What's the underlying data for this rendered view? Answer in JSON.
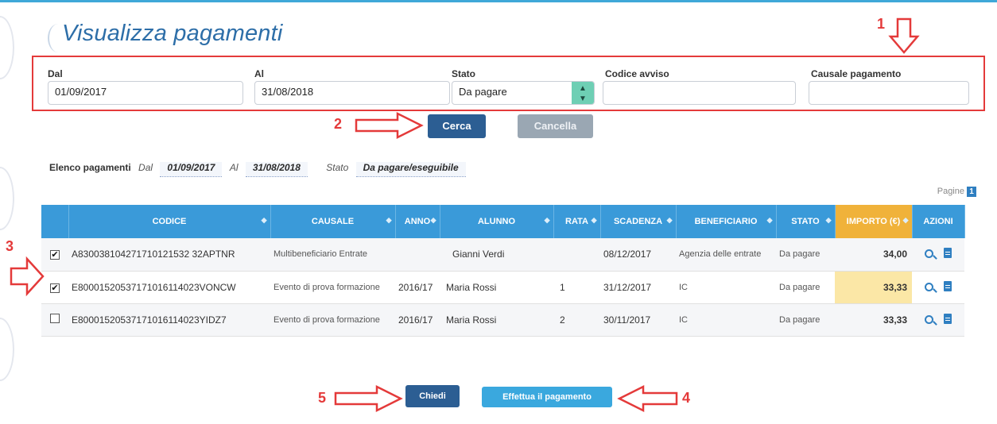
{
  "header": {
    "title": "Visualizza pagamenti"
  },
  "filters": {
    "dal": {
      "label": "Dal",
      "value": "01/09/2017"
    },
    "al": {
      "label": "Al",
      "value": "31/08/2018"
    },
    "stato": {
      "label": "Stato",
      "value": "Da pagare"
    },
    "codice_avviso": {
      "label": "Codice avviso",
      "value": ""
    },
    "causale": {
      "label": "Causale pagamento",
      "value": ""
    }
  },
  "buttons": {
    "cerca": "Cerca",
    "cancella": "Cancella",
    "chiedi": "Chiedi",
    "effettua": "Effettua il pagamento"
  },
  "annotations": {
    "n1": "1",
    "n2": "2",
    "n3": "3",
    "n4": "4",
    "n5": "5",
    "color": "#e43a3a"
  },
  "summary": {
    "label": "Elenco pagamenti",
    "dal_label": "Dal",
    "dal_value": "01/09/2017",
    "al_label": "Al",
    "al_value": "31/08/2018",
    "stato_label": "Stato",
    "stato_value": "Da pagare/eseguibile"
  },
  "pagination": {
    "label": "Pagine",
    "current": "1"
  },
  "table": {
    "headers": [
      "CODICE",
      "CAUSALE",
      "ANNO",
      "ALUNNO",
      "RATA",
      "SCADENZA",
      "BENEFICIARIO",
      "STATO",
      "IMPORTO (€)",
      "AZIONI"
    ],
    "rows": [
      {
        "checked": "✔",
        "codice": "A830038104271710121532 32APTNR",
        "causale": "Multibeneficiario Entrate",
        "anno": "",
        "alunno": "Gianni Verdi",
        "rata": "",
        "scadenza": "08/12/2017",
        "beneficiario": "Agenzia delle entrate",
        "stato": "Da pagare",
        "importo": "34,00"
      },
      {
        "checked": "✔",
        "codice": "E80001520537171016114023VONCW",
        "causale": "Evento di prova formazione",
        "anno": "2016/17",
        "alunno": "Maria Rossi",
        "rata": "1",
        "scadenza": "31/12/2017",
        "beneficiario": "IC",
        "stato": "Da pagare",
        "importo": "33,33"
      },
      {
        "checked": "",
        "codice": "E80001520537171016114023YIDZ7",
        "causale": "Evento di prova formazione",
        "anno": "2016/17",
        "alunno": "Maria Rossi",
        "rata": "2",
        "scadenza": "30/11/2017",
        "beneficiario": "IC",
        "stato": "Da pagare",
        "importo": "33,33"
      }
    ]
  },
  "colors": {
    "accent": "#3a9ad9",
    "primary_button": "#2c5e93",
    "importo_highlight": "#fbe7a6"
  }
}
